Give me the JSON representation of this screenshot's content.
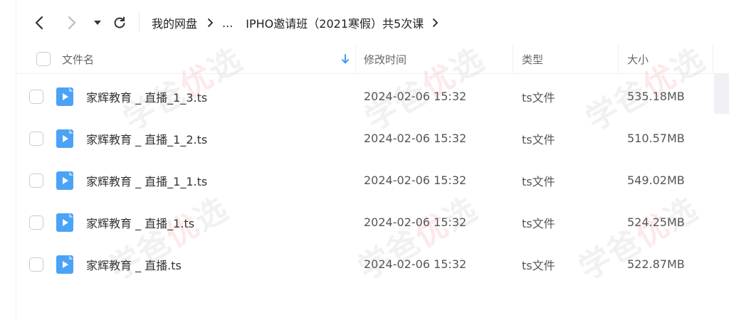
{
  "toolbar": {
    "breadcrumb": {
      "root": "我的网盘",
      "ellipsis": "...",
      "current": "IPHO邀请班（2021寒假）共5次课"
    }
  },
  "table": {
    "columns": {
      "name": "文件名",
      "modified": "修改时间",
      "type": "类型",
      "size": "大小"
    },
    "rows": [
      {
        "name": "家辉教育 _ 直播_1_3.ts",
        "modified": "2024-02-06 15:32",
        "type": "ts文件",
        "size": "535.18MB"
      },
      {
        "name": "家辉教育 _ 直播_1_2.ts",
        "modified": "2024-02-06 15:32",
        "type": "ts文件",
        "size": "510.57MB"
      },
      {
        "name": "家辉教育 _ 直播_1_1.ts",
        "modified": "2024-02-06 15:32",
        "type": "ts文件",
        "size": "549.02MB"
      },
      {
        "name": "家辉教育 _ 直播_1.ts",
        "modified": "2024-02-06 15:32",
        "type": "ts文件",
        "size": "524.25MB"
      },
      {
        "name": "家辉教育 _ 直播.ts",
        "modified": "2024-02-06 15:32",
        "type": "ts文件",
        "size": "522.87MB"
      }
    ]
  },
  "watermark": {
    "text_a": "学爸",
    "text_b": "优",
    "text_c": "选"
  },
  "colors": {
    "accent": "#3b9bf5",
    "file_icon": "#4aa3f7"
  },
  "icons": {
    "back": "chevron-left-icon",
    "forward": "chevron-right-icon",
    "history": "caret-down-icon",
    "refresh": "refresh-icon",
    "sort": "arrow-down-icon",
    "file": "video-file-icon"
  }
}
